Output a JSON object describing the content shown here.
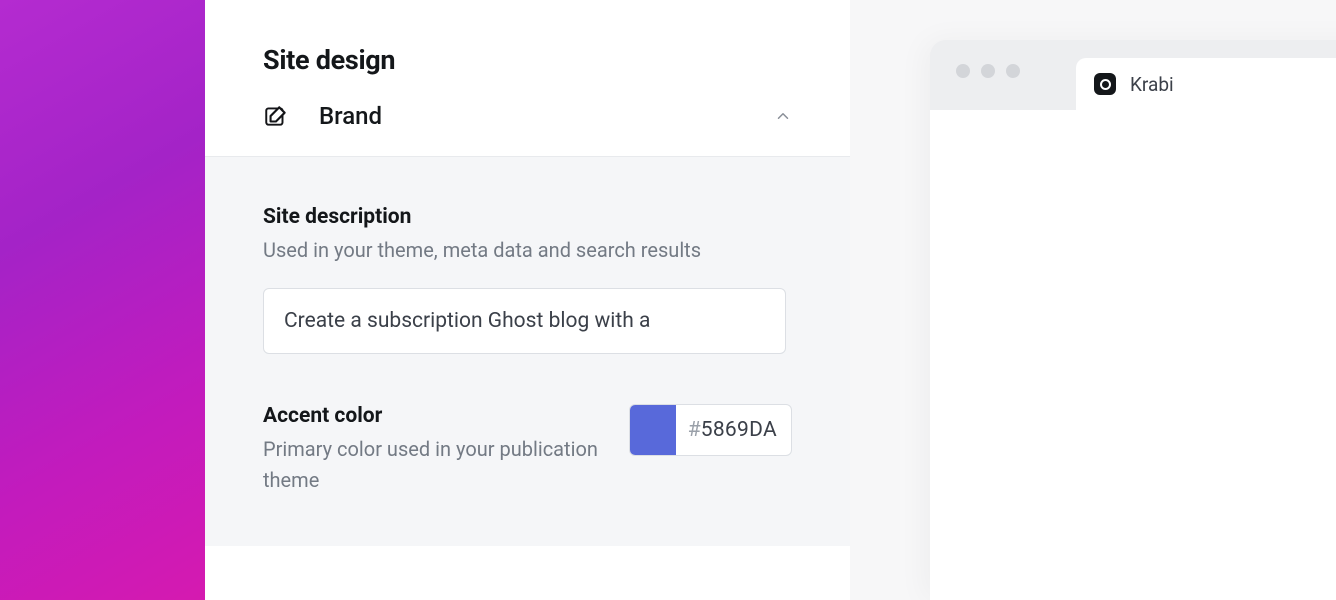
{
  "panel": {
    "title": "Site design",
    "brand": {
      "label": "Brand",
      "site_description": {
        "title": "Site description",
        "help": "Used in your theme, meta data and search results",
        "value": "Create a subscription Ghost blog with a"
      },
      "accent_color": {
        "title": "Accent color",
        "help": "Primary color used in your publication theme",
        "hash": "#",
        "hex": "5869DA"
      }
    }
  },
  "preview": {
    "tab_title": "Krabi"
  }
}
